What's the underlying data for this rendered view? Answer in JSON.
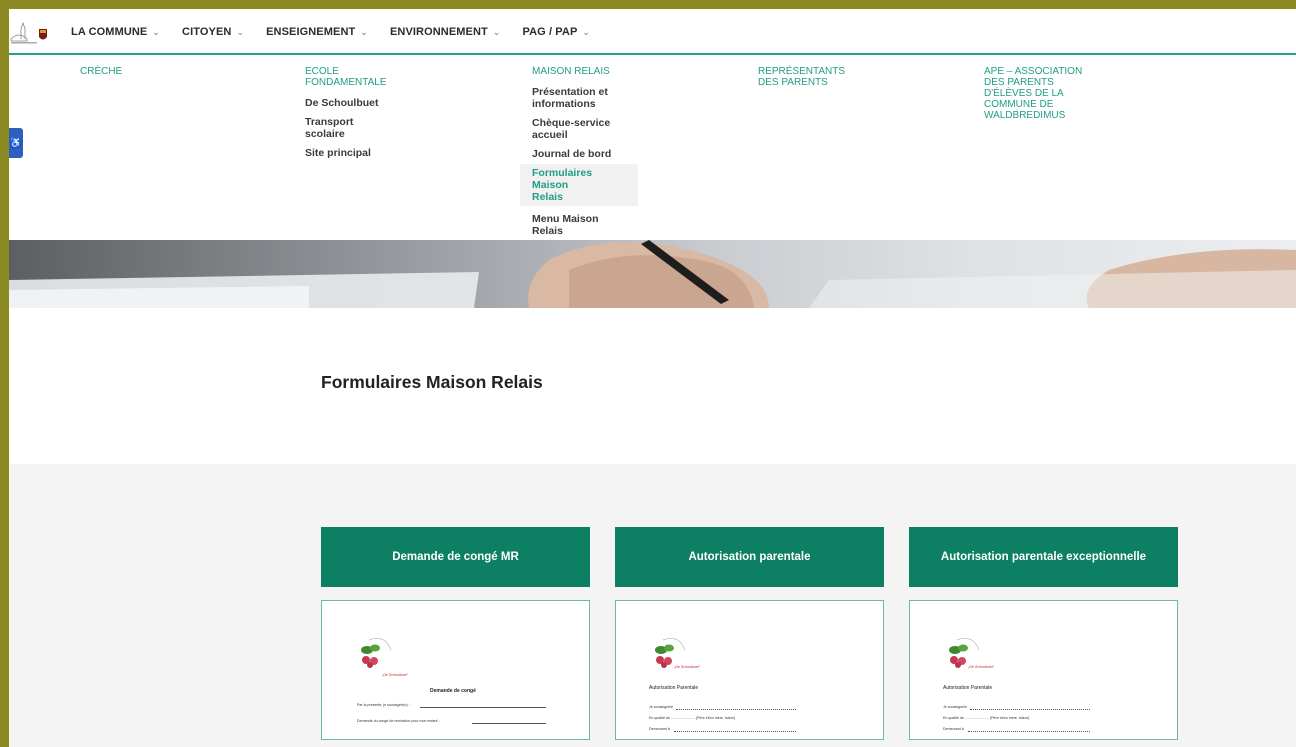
{
  "nav": {
    "items": [
      {
        "label": "LA COMMUNE"
      },
      {
        "label": "CITOYEN"
      },
      {
        "label": "ENSEIGNEMENT"
      },
      {
        "label": "ENVIRONNEMENT"
      },
      {
        "label": "PAG / PAP"
      }
    ],
    "chevron": "⌄"
  },
  "menu": {
    "col1": {
      "head": "CRÈCHE"
    },
    "col2": {
      "head": "ECOLE FONDAMENTALE",
      "items": [
        "De Schoulbuet",
        "Transport scolaire",
        "Site principal"
      ]
    },
    "col3": {
      "head": "MAISON RELAIS",
      "items": [
        "Présentation et informations",
        "Chèque-service accueil",
        "Journal de bord",
        "Formulaires Maison Relais",
        "Menu Maison Relais"
      ]
    },
    "col4": {
      "head": "REPRÉSENTANTS DES PARENTS"
    },
    "col5": {
      "head": "APE – ASSOCIATION DES PARENTS D'ÉLÈVES DE LA COMMUNE DE WALDBREDIMUS"
    }
  },
  "page": {
    "title": "Formulaires Maison Relais"
  },
  "cards": [
    {
      "title": "Demande de congé MR",
      "doc_title": "Demande de congé",
      "lines": [
        "Par la présente, je soussigné(e) :",
        "Demande du congé de récréation pour mon enfant :"
      ]
    },
    {
      "title": "Autorisation parentale",
      "doc_title": "Autorisation Parentale",
      "lines": [
        "Je soussigné/e",
        "En qualité de ........................ (Père et/ou mère, tuteur)",
        "Demeurant à"
      ]
    },
    {
      "title": "Autorisation parentale exceptionnelle",
      "doc_title": "Autorisation Parentale",
      "lines": [
        "Je soussigné/e",
        "En qualité de ........................ (Père et/ou mère, tuteur)",
        "Demeurant à"
      ]
    }
  ],
  "doc_logo_text": "„De Schoulbuet\"",
  "colors": {
    "accent": "#1f9e84",
    "card_header": "#0d7f63",
    "border": "#8c8a22"
  },
  "icons": {
    "accessibility": "accessibility-icon"
  }
}
